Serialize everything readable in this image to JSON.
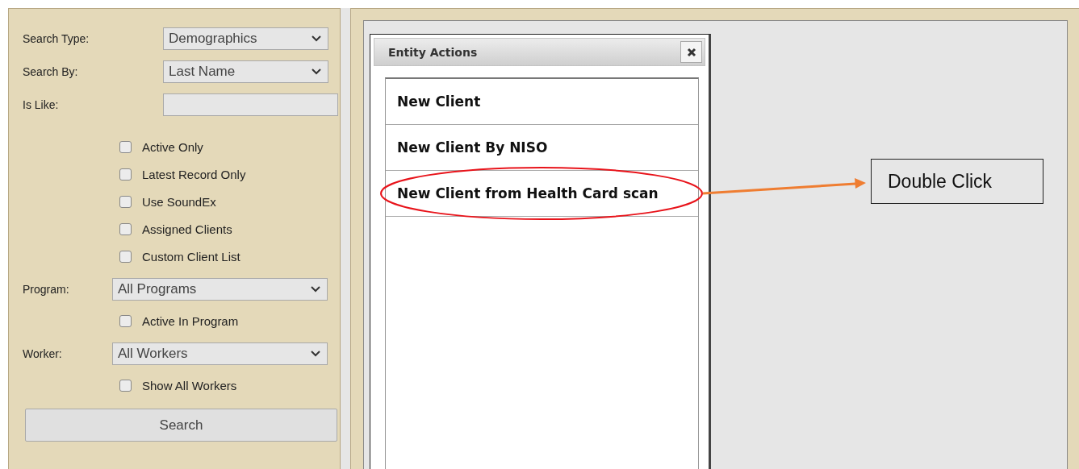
{
  "search_panel": {
    "rows": [
      {
        "kind": "select",
        "label": "Search Type:",
        "value": "Demographics"
      },
      {
        "kind": "select",
        "label": "Search By:",
        "value": "Last Name"
      },
      {
        "kind": "text",
        "label": "Is Like:"
      },
      {
        "kind": "checkbox",
        "label": "Active Only",
        "checked": false
      },
      {
        "kind": "checkbox",
        "label": "Latest Record Only",
        "checked": false
      },
      {
        "kind": "checkbox",
        "label": "Use SoundEx",
        "checked": false
      },
      {
        "kind": "checkbox",
        "label": "Assigned Clients",
        "checked": false
      },
      {
        "kind": "checkbox",
        "label": "Custom Client List",
        "checked": false
      },
      {
        "kind": "select",
        "label": "Program:",
        "value": "All Programs"
      },
      {
        "kind": "checkbox",
        "label": "Active In Program",
        "checked": false
      },
      {
        "kind": "select",
        "label": "Worker:",
        "value": "All Workers"
      },
      {
        "kind": "checkbox",
        "label": "Show All Workers",
        "checked": false
      }
    ],
    "button": "Search"
  },
  "dialog": {
    "title": "Entity Actions",
    "items": [
      {
        "label": "New Client",
        "circled": false
      },
      {
        "label": "New Client By NISO",
        "circled": false
      },
      {
        "label": "New Client from Health Card scan",
        "circled": true
      }
    ]
  },
  "annotation": {
    "callout": "Double Click"
  }
}
